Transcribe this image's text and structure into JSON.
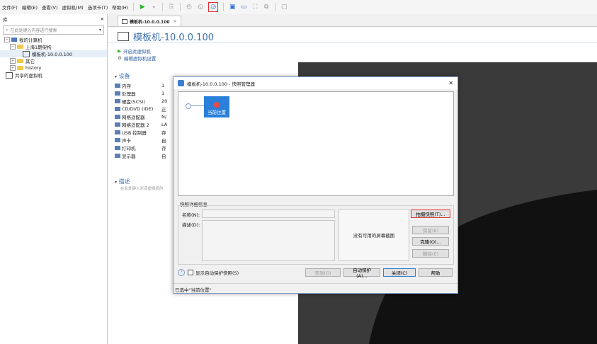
{
  "menubar": {
    "items": [
      "文件(F)",
      "编辑(E)",
      "查看(V)",
      "虚拟机(M)",
      "选项卡(T)",
      "帮助(H)"
    ]
  },
  "library": {
    "title": "库",
    "search_placeholder": "在此处键入内容进行搜索",
    "tree": {
      "root": "我的计算机",
      "folder1": "上海1期架构",
      "vm1": "模板机-10.0.0.100",
      "folder2": "其它",
      "folder3": "history",
      "shared": "共享的虚拟机"
    }
  },
  "tab": {
    "label": "模板机-10.0.0.100"
  },
  "vm": {
    "title": "模板机-10.0.0.100",
    "power_on": "开启此虚拟机",
    "edit_settings": "编辑虚拟机设置",
    "devices_header": "设备",
    "devices": [
      {
        "name": "内存",
        "value": "1"
      },
      {
        "name": "处理器",
        "value": "1"
      },
      {
        "name": "硬盘(SCSI)",
        "value": "20"
      },
      {
        "name": "CD/DVD (IDE)",
        "value": "正"
      },
      {
        "name": "网络适配器",
        "value": "N/"
      },
      {
        "name": "网络适配器 2",
        "value": "LA"
      },
      {
        "name": "USB 控制器",
        "value": "存"
      },
      {
        "name": "声卡",
        "value": "自"
      },
      {
        "name": "打印机",
        "value": "存"
      },
      {
        "name": "显示器",
        "value": "自"
      }
    ],
    "desc_header": "描述",
    "desc_placeholder": "在此处键入对该虚拟机的"
  },
  "dialog": {
    "title": "模板机-10.0.0.100 - 快照管理器",
    "current_pos": "当前位置",
    "details_header": "快照详细信息",
    "name_label": "名称(N):",
    "desc_label": "描述(D):",
    "no_screenshot": "没有可用的屏幕截图",
    "take_snapshot": "拍摄快照(T)...",
    "keep": "保留(K)",
    "clone": "克隆(O)...",
    "delete": "删除(E)",
    "autoprotect_check": "显示自动保护快照(S)",
    "goto": "转到(G)",
    "autoprotect_btn": "自动保护(A)...",
    "close": "关闭(C)",
    "help": "帮助",
    "status": "已选中\"当前位置\""
  }
}
